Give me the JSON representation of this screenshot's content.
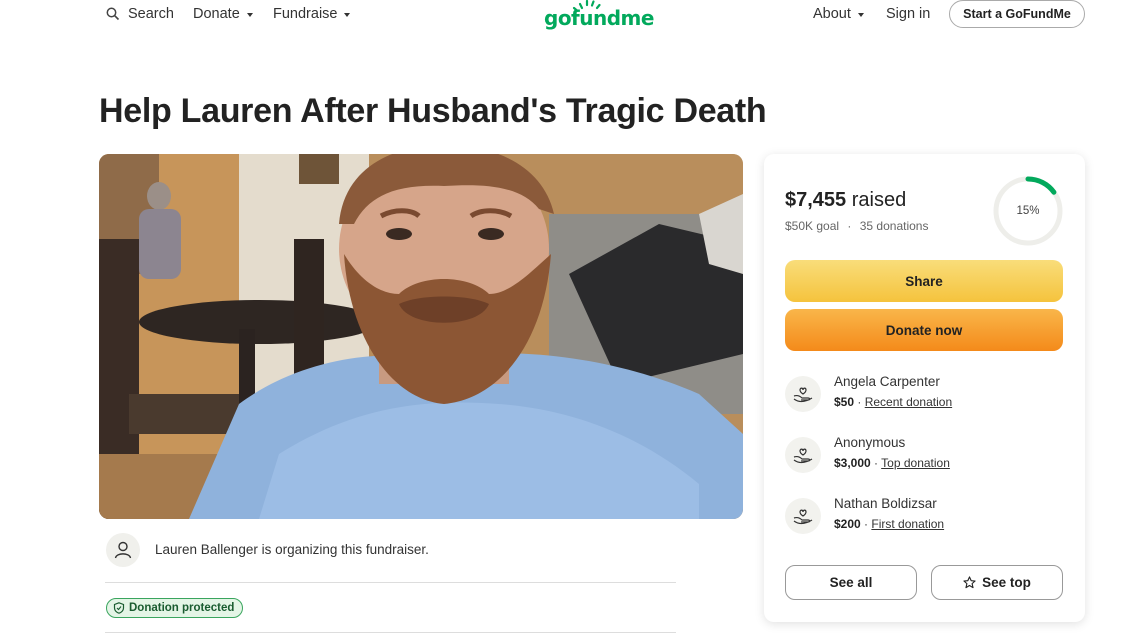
{
  "header": {
    "search_label": "Search",
    "donate_label": "Donate",
    "fundraise_label": "Fundraise",
    "logo_text": "gofundme",
    "about_label": "About",
    "signin_label": "Sign in",
    "start_label": "Start a GoFundMe"
  },
  "campaign": {
    "title": "Help Lauren After Husband's Tragic Death",
    "organizer_text": "Lauren Ballenger is organizing this fundraiser.",
    "protected_label": "Donation protected"
  },
  "card": {
    "raised_amount": "$7,455",
    "raised_suffix": "raised",
    "goal": "$50K goal",
    "separator": "·",
    "donations_count": "35 donations",
    "progress_label": "15%",
    "progress_fraction": 0.15,
    "share_label": "Share",
    "donate_now_label": "Donate now",
    "donations": [
      {
        "name": "Angela Carpenter",
        "amount": "$50",
        "sep": "·",
        "type": "Recent donation"
      },
      {
        "name": "Anonymous",
        "amount": "$3,000",
        "sep": "·",
        "type": "Top donation"
      },
      {
        "name": "Nathan Boldizsar",
        "amount": "$200",
        "sep": "·",
        "type": "First donation"
      }
    ],
    "see_all_label": "See all",
    "see_top_label": "See top"
  },
  "colors": {
    "brand_green": "#02a95c",
    "share_yellow": "#f5c33d",
    "donate_orange": "#f48a1a"
  }
}
